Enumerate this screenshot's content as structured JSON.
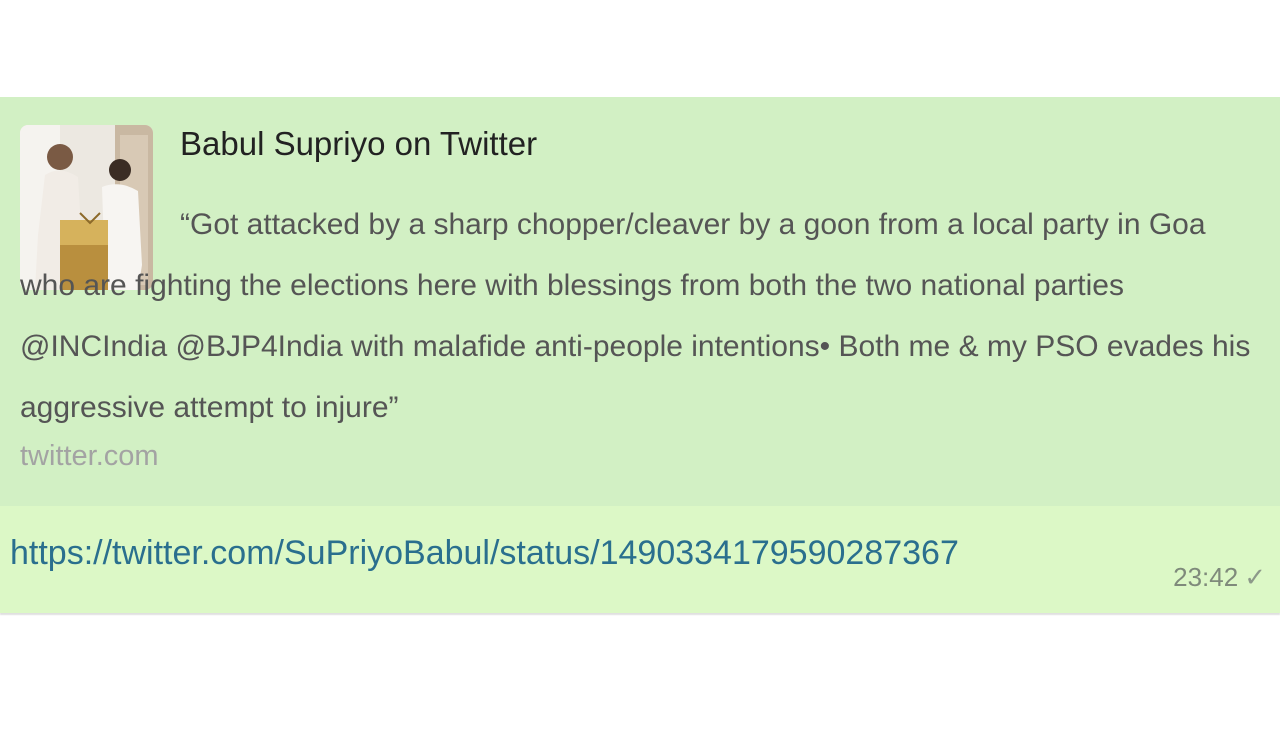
{
  "message": {
    "preview": {
      "title": "Babul Supriyo on Twitter",
      "description": "“Got attacked by a sharp chopper/cleaver by a goon from a local party in Goa who are fighting the elections here with blessings from both the two national parties @INCIndia @BJP4India with malafide anti-people intentions• Both me & my PSO evades his aggressive attempt to injure”",
      "domain": "twitter.com",
      "thumbnail_icon": "tweet-photo"
    },
    "url": "https://twitter.com/SuPriyoBabul/status/1490334179590287367",
    "time": "23:42",
    "status_icon": "single-check",
    "status_glyph": "✓"
  },
  "colors": {
    "bubble": "#dcf8c6",
    "preview_bg": "#d2f0c4",
    "link": "#2a6f8e"
  }
}
